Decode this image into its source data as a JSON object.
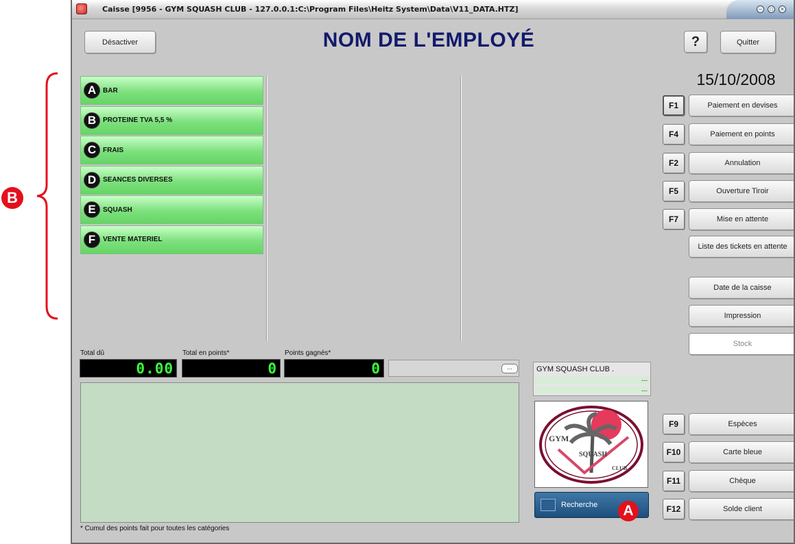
{
  "window": {
    "title": "Caisse [9956 - GYM SQUASH CLUB - 127.0.0.1:C:\\Program Files\\Heitz System\\Data\\V11_DATA.HTZ]"
  },
  "header": {
    "deactivate_label": "Désactiver",
    "employee_title": "NOM DE L'EMPLOYÉ",
    "help_label": "?",
    "quit_label": "Quitter"
  },
  "categories": [
    {
      "letter": "A",
      "label": "BAR"
    },
    {
      "letter": "B",
      "label": "PROTEINE TVA 5,5 %"
    },
    {
      "letter": "C",
      "label": "FRAIS"
    },
    {
      "letter": "D",
      "label": "SEANCES DIVERSES"
    },
    {
      "letter": "E",
      "label": "SQUASH"
    },
    {
      "letter": "F",
      "label": "VENTE MATERIEL"
    }
  ],
  "date": "15/10/2008",
  "actions": [
    {
      "key": "F1",
      "label": "Paiement en devises"
    },
    {
      "key": "F4",
      "label": "Paiement en points"
    },
    {
      "key": "F2",
      "label": "Annulation"
    },
    {
      "key": "F5",
      "label": "Ouverture Tiroir"
    },
    {
      "key": "F7",
      "label": "Mise en attente"
    },
    {
      "key": "",
      "label": "Liste des tickets en attente"
    },
    {
      "key": "",
      "label": "Date de la caisse"
    },
    {
      "key": "",
      "label": "Impression"
    },
    {
      "key": "",
      "label": "Stock"
    }
  ],
  "payments": [
    {
      "key": "F9",
      "label": "Espèces"
    },
    {
      "key": "F10",
      "label": "Carte bleue"
    },
    {
      "key": "F11",
      "label": "Chèque"
    },
    {
      "key": "F12",
      "label": "Solde client"
    }
  ],
  "totals": {
    "total_due_label": "Total dû",
    "total_due_value": "0.00",
    "total_points_label": "Total en points*",
    "total_points_value": "0",
    "points_earned_label": "Points gagnés*",
    "points_earned_value": "0",
    "dots_label": "..."
  },
  "footnote": "* Cumul des points fait pour toutes les catégories",
  "shop": {
    "name": "GYM SQUASH CLUB .",
    "line1": "---",
    "line2": "---"
  },
  "logo": {
    "text_gym": "GYM",
    "text_squash": "SQUASH",
    "text_club": "CLUB"
  },
  "search_label": "Recherche",
  "markers": {
    "a": "A",
    "b": "B"
  },
  "colors": {
    "category_green": "#7de07d",
    "title_navy": "#121a6b",
    "marker_red": "#e3111b",
    "display_green": "#3cff3c"
  }
}
